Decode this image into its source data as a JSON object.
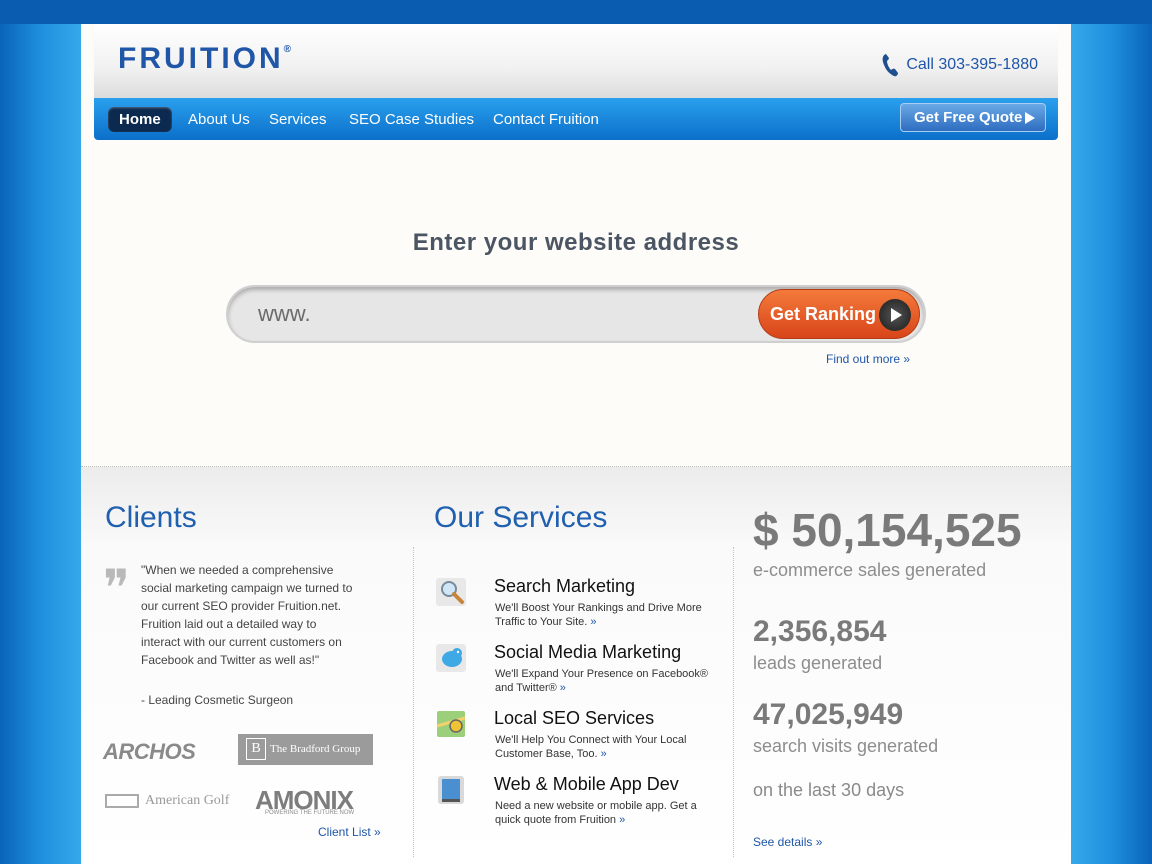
{
  "header": {
    "logo_text": "FRUITION",
    "logo_mark": "®",
    "phone": "Call 303-395-1880"
  },
  "nav": {
    "items": [
      {
        "label": "Home",
        "active": true
      },
      {
        "label": "About Us"
      },
      {
        "label": "Services"
      },
      {
        "label": "SEO Case Studies"
      },
      {
        "label": "Contact Fruition"
      }
    ],
    "quote_button": "Get Free Quote"
  },
  "hero": {
    "title": "Enter your website address",
    "input_value": "www.",
    "button": "Get Ranking",
    "find_more": "Find out more »"
  },
  "clients": {
    "title": "Clients",
    "testimonial": "\"When we needed a comprehensive social marketing campaign we turned to our current SEO provider Fruition.net. Fruition laid out a detailed way to interact with our current customers on Facebook and Twitter as well as!\"",
    "author": "- Leading Cosmetic Surgeon",
    "logos": [
      "ARCHOS",
      "The Bradford Group",
      "American Golf",
      "AMONIX"
    ],
    "amonix_tagline": "POWERING THE FUTURE NOW",
    "client_list": "Client List »"
  },
  "services": {
    "title": "Our Services",
    "items": [
      {
        "title": "Search Marketing",
        "desc": "We'll Boost Your Rankings and Drive More Traffic to Your Site.",
        "icon": "magnifier-icon"
      },
      {
        "title": "Social Media Marketing",
        "desc": "We'll Expand Your Presence on Facebook® and Twitter®",
        "icon": "bird-icon"
      },
      {
        "title": "Local SEO Services",
        "desc": "We'll Help You Connect with Your Local Customer Base, Too.",
        "icon": "map-icon"
      },
      {
        "title": "Web & Mobile App Dev",
        "desc": "Need a new website or mobile app. Get a quick quote from Fruition",
        "icon": "mobile-device-icon"
      }
    ],
    "more": "»"
  },
  "stats": {
    "sales": "$ 50,154,525",
    "sales_label": "e-commerce sales generated",
    "leads": "2,356,854",
    "leads_label": "leads generated",
    "visits": "47,025,949",
    "visits_label": "search visits generated",
    "period": "on the last 30 days",
    "details": "See details »"
  },
  "colors": {
    "brand_blue": "#1f56a8",
    "nav_blue": "#1a88de",
    "cta_orange": "#e8571f"
  }
}
